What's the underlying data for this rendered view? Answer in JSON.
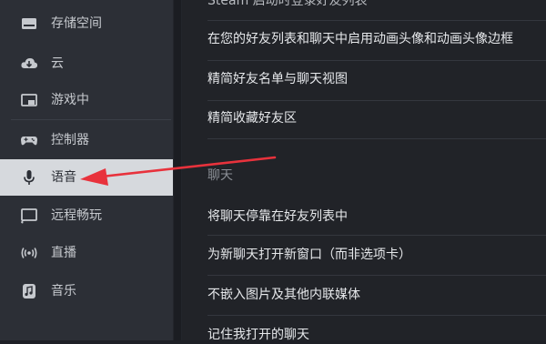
{
  "sidebar": {
    "items": [
      {
        "label": "存储空间",
        "icon": "storage-drive-icon"
      },
      {
        "label": "云",
        "icon": "cloud-sync-icon"
      },
      {
        "label": "游戏中",
        "icon": "in-game-overlay-icon"
      },
      {
        "label": "控制器",
        "icon": "gamepad-icon"
      },
      {
        "label": "语音",
        "icon": "microphone-icon",
        "selected": true
      },
      {
        "label": "远程畅玩",
        "icon": "remote-play-icon"
      },
      {
        "label": "直播",
        "icon": "broadcast-icon"
      },
      {
        "label": "音乐",
        "icon": "music-note-icon"
      }
    ]
  },
  "content": {
    "cut_top_text": "Steam 启动时登录好友列表",
    "options": [
      "在您的好友列表和聊天中启用动画头像和动画头像边框",
      "精简好友名单与聊天视图",
      "精简收藏好友区"
    ],
    "chat_section_title": "聊天",
    "chat_options": [
      "将聊天停靠在好友列表中",
      "为新聊天打开新窗口（而非选项卡）",
      "不嵌入图片及其他内联媒体",
      "记住我打开的聊天"
    ]
  },
  "colors": {
    "sidebar_bg": "#2c2f36",
    "selected_bg": "#d6d9dd",
    "content_bg": "#212328",
    "annotation_arrow": "#e8323c"
  }
}
